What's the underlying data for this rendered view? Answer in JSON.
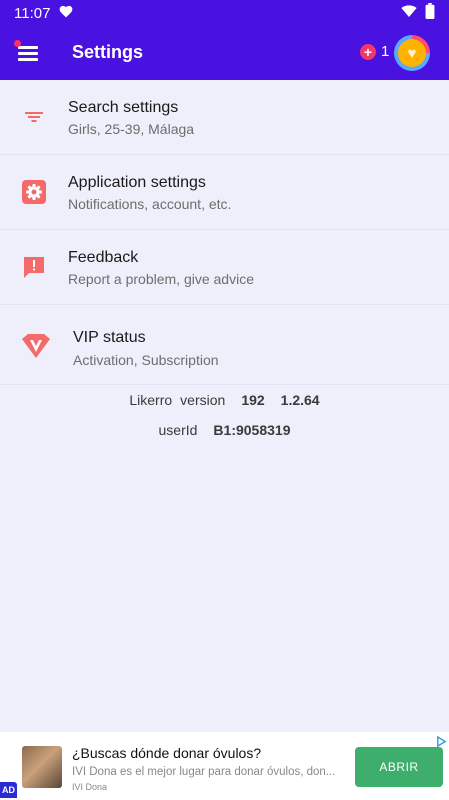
{
  "status_bar": {
    "time": "11:07"
  },
  "app_bar": {
    "title": "Settings",
    "credits_count": "1"
  },
  "settings_items": [
    {
      "title": "Search settings",
      "subtitle": "Girls, 25-39, Málaga",
      "icon": "filter-icon"
    },
    {
      "title": "Application settings",
      "subtitle": "Notifications, account, etc.",
      "icon": "gear-icon"
    },
    {
      "title": "Feedback",
      "subtitle": "Report a problem, give advice",
      "icon": "feedback-icon"
    },
    {
      "title": "VIP status",
      "subtitle": "Activation, Subscription",
      "icon": "vip-diamond-icon"
    }
  ],
  "version_info": {
    "app_name": "Likerro",
    "version_label": "version",
    "build": "192",
    "version": "1.2.64"
  },
  "user_info": {
    "label": "userId",
    "value": "B1:9058319"
  },
  "ad": {
    "title": "¿Buscas dónde donar óvulos?",
    "description": "IVI Dona es el mejor lugar para donar óvulos, don...",
    "source": "IVI Dona",
    "cta": "ABRIR",
    "badge": "AD"
  },
  "colors": {
    "primary": "#4a12e0",
    "accent": "#f0386b",
    "icon_red": "#f46a6a",
    "background": "#eeeffb",
    "ad_button": "#3dae6c"
  }
}
